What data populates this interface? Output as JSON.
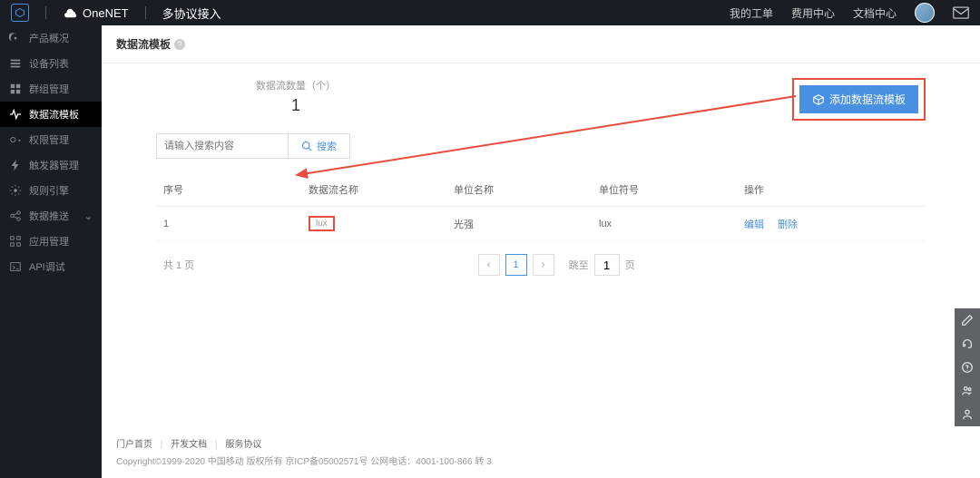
{
  "topbar": {
    "brand": "OneNET",
    "subtitle": "多协议接入",
    "links": {
      "orders": "我的工单",
      "billing": "费用中心",
      "docs": "文档中心"
    }
  },
  "sidebar": {
    "items": [
      {
        "label": "产品概况"
      },
      {
        "label": "设备列表"
      },
      {
        "label": "群组管理"
      },
      {
        "label": "数据流模板"
      },
      {
        "label": "权限管理"
      },
      {
        "label": "触发器管理"
      },
      {
        "label": "规则引擎"
      },
      {
        "label": "数据推送"
      },
      {
        "label": "应用管理"
      },
      {
        "label": "API调试"
      }
    ]
  },
  "page": {
    "title": "数据流模板",
    "stats_label": "数据流数量（个）",
    "stats_value": "1",
    "add_button": "添加数据流模板",
    "search_placeholder": "请输入搜索内容",
    "search_button": "搜索"
  },
  "table": {
    "headers": {
      "seq": "序号",
      "name": "数据流名称",
      "unit": "单位名称",
      "sym": "单位符号",
      "op": "操作"
    },
    "rows": [
      {
        "seq": "1",
        "name": "lux",
        "unit": "光强",
        "sym": "lux"
      }
    ],
    "ops": {
      "edit": "编辑",
      "delete": "删除"
    }
  },
  "pagination": {
    "total_text": "共 1 页",
    "current": "1",
    "goto_label": "跳至",
    "goto_value": "1",
    "page_suffix": "页"
  },
  "footer": {
    "links": {
      "portal": "门户首页",
      "dev": "开发文档",
      "terms": "服务协议"
    },
    "copyright": "Copyright©1999-2020 中国移动 版权所有 京ICP备05002571号 公网电话：4001-100-866 转 3"
  }
}
